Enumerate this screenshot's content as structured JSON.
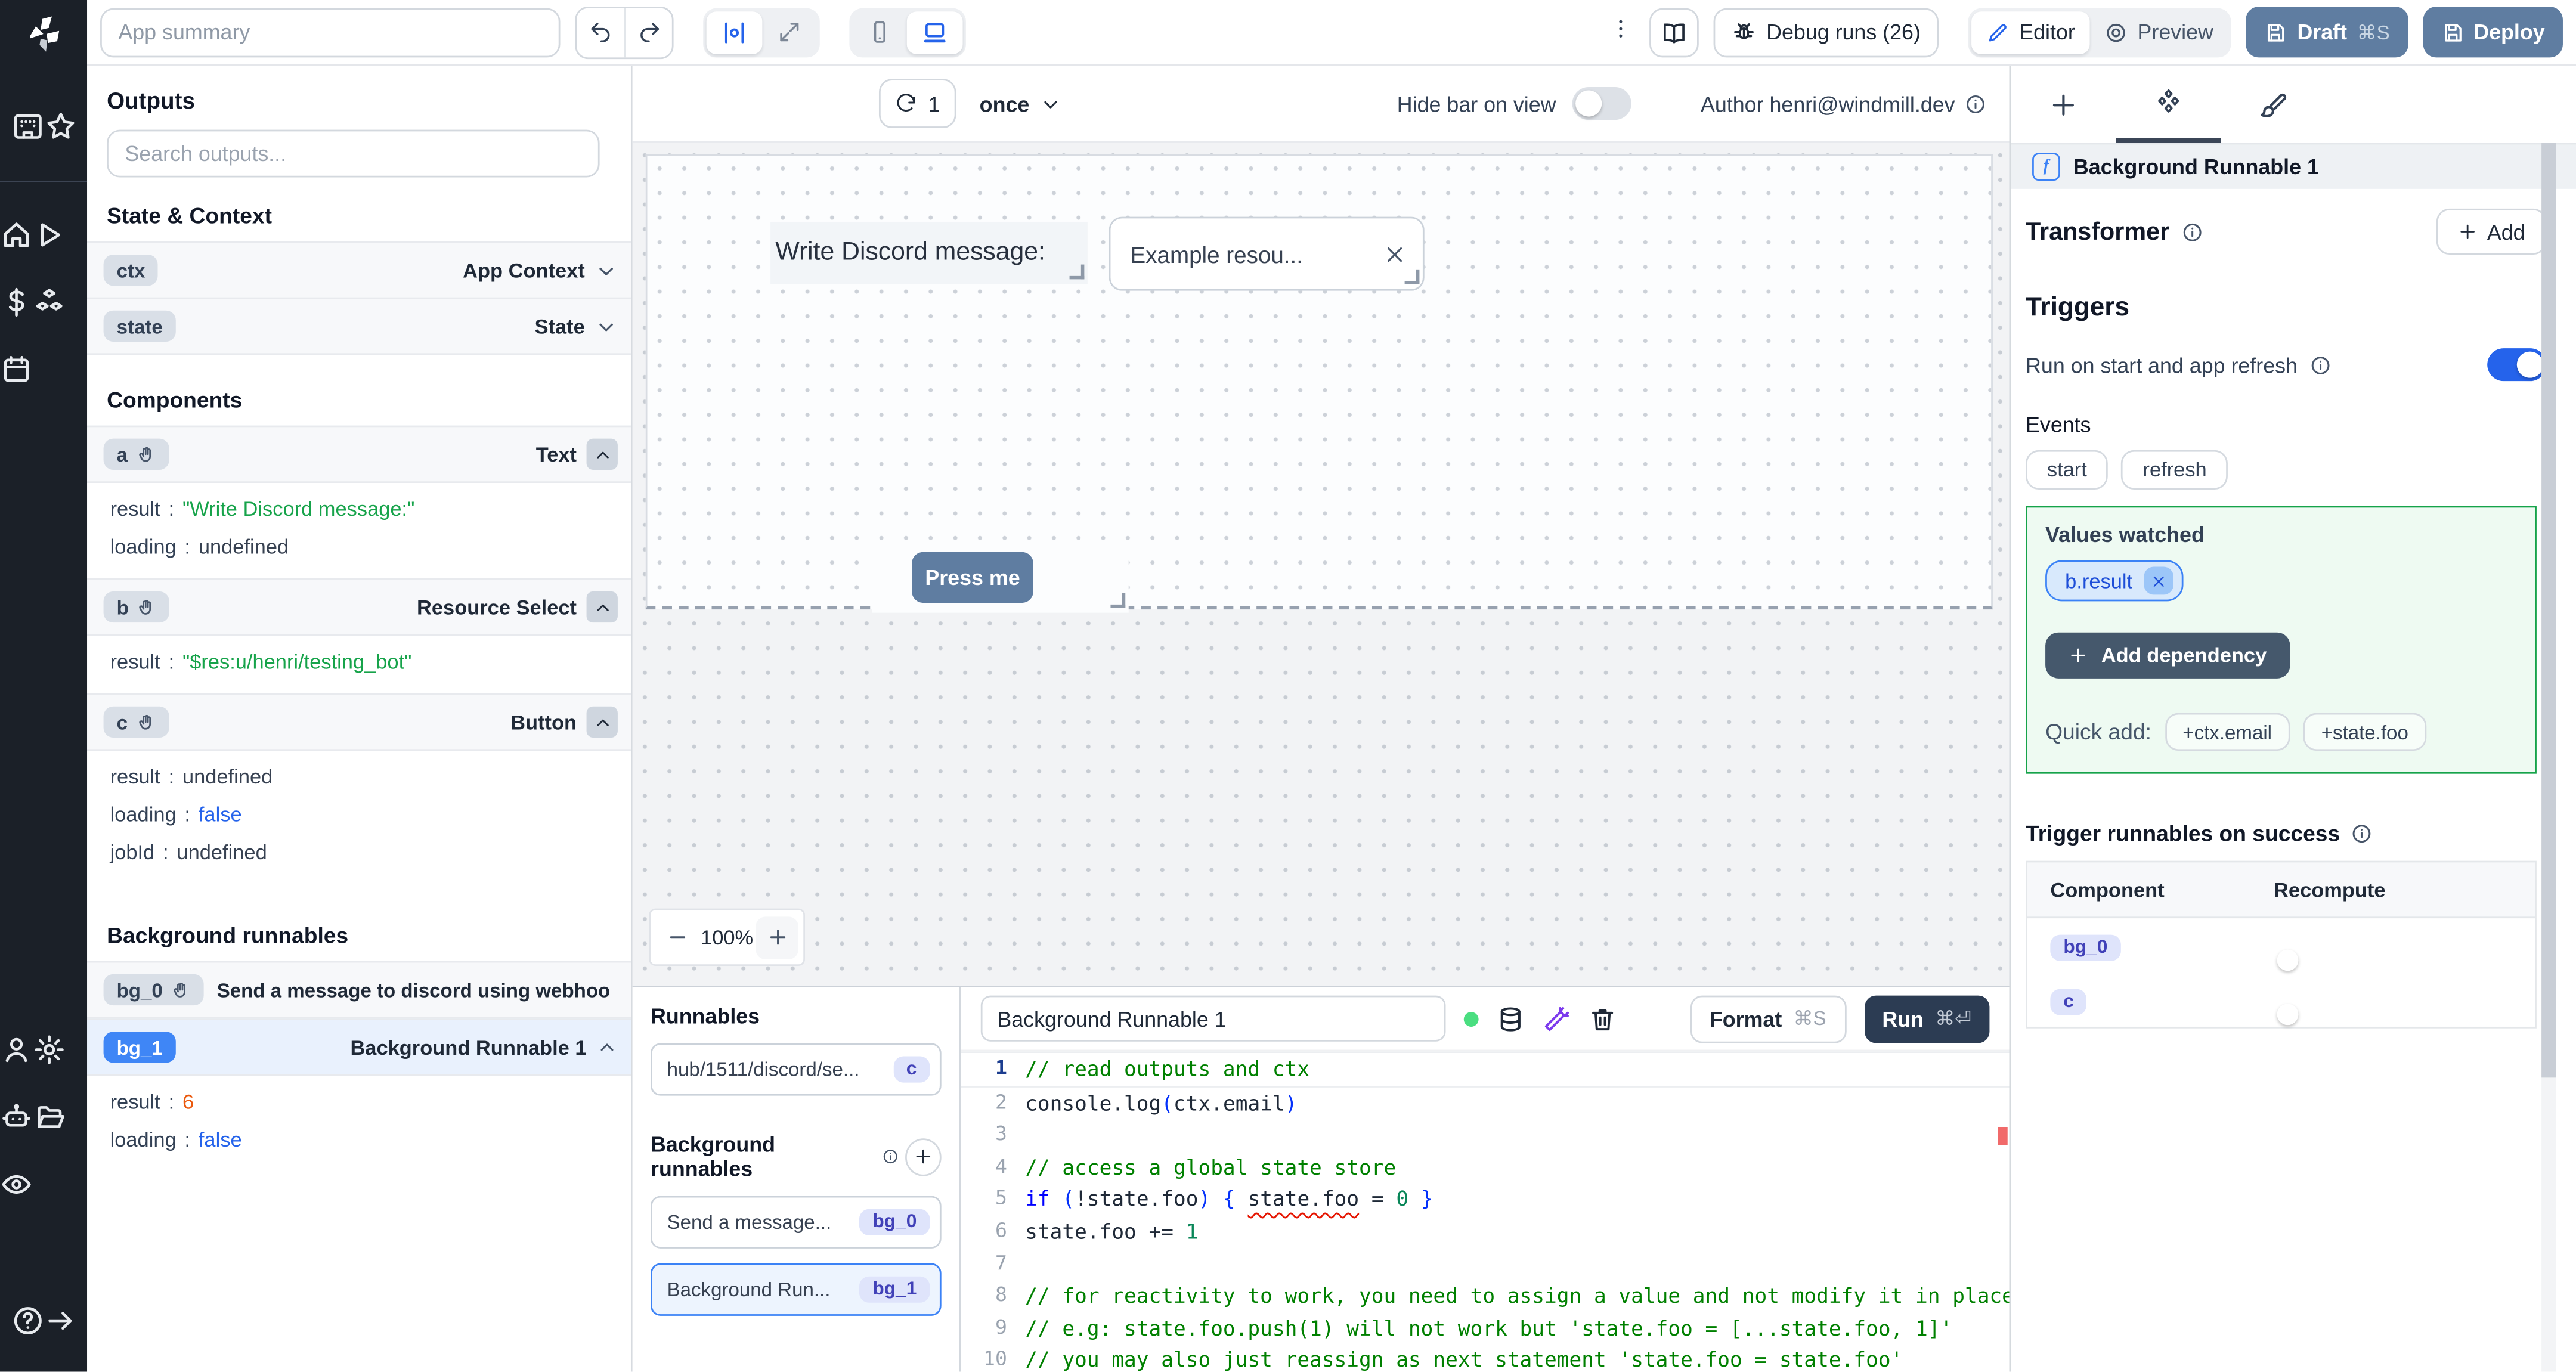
{
  "topbar": {
    "app_summary_placeholder": "App summary",
    "debug_runs_label": "Debug runs (26)",
    "editor_label": "Editor",
    "preview_label": "Preview",
    "draft_label": "Draft",
    "draft_shortcut": "⌘S",
    "deploy_label": "Deploy"
  },
  "left_rail": {
    "top_icons": [
      "apps",
      "star"
    ],
    "mid_icons": [
      "home",
      "play",
      "dollar",
      "cubes",
      "calendar"
    ],
    "bottom_icons": [
      "user",
      "settings",
      "robot",
      "folder-open",
      "eye"
    ],
    "footer_icons": [
      "help-circle",
      "arrow-right"
    ]
  },
  "outputs_panel": {
    "title": "Outputs",
    "search_placeholder": "Search outputs...",
    "state_context_title": "State & Context",
    "state_context_rows": [
      {
        "id": "ctx",
        "type": "App Context"
      },
      {
        "id": "state",
        "type": "State"
      }
    ],
    "components_title": "Components",
    "components": [
      {
        "id": "a",
        "type": "Text",
        "props": [
          {
            "key": "result",
            "value": "\"Write Discord message:\"",
            "kind": "string"
          },
          {
            "key": "loading",
            "value": "undefined",
            "kind": "undefined"
          }
        ]
      },
      {
        "id": "b",
        "type": "Resource Select",
        "props": [
          {
            "key": "result",
            "value": "\"$res:u/henri/testing_bot\"",
            "kind": "string"
          }
        ]
      },
      {
        "id": "c",
        "type": "Button",
        "props": [
          {
            "key": "result",
            "value": "undefined",
            "kind": "undefined"
          },
          {
            "key": "loading",
            "value": "false",
            "kind": "bool"
          },
          {
            "key": "jobId",
            "value": "undefined",
            "kind": "undefined"
          }
        ]
      }
    ],
    "background_title": "Background runnables",
    "background": [
      {
        "id": "bg_0",
        "type": "Send a message to discord using webhoo",
        "selected": false,
        "label_left": true,
        "hand": true,
        "chevron": false,
        "props": []
      },
      {
        "id": "bg_1",
        "type": "Background Runnable 1",
        "selected": true,
        "label_left": false,
        "hand": false,
        "chevron": true,
        "props": [
          {
            "key": "result",
            "value": "6",
            "kind": "number"
          },
          {
            "key": "loading",
            "value": "false",
            "kind": "bool"
          }
        ]
      }
    ]
  },
  "canvas": {
    "refresh_count": "1",
    "frequency": "once",
    "hide_bar_label": "Hide bar on view",
    "author_label": "Author henri@windmill.dev",
    "zoom_label": "100%",
    "widgets": {
      "text": "Write Discord message:",
      "select_value": "Example resou...",
      "button_label": "Press me"
    }
  },
  "runnables_panel": {
    "title": "Runnables",
    "items": [
      {
        "label": "hub/1511/discord/se...",
        "badge": "c",
        "selected": false
      }
    ],
    "background_title": "Background runnables",
    "background_items": [
      {
        "label": "Send a message...",
        "badge": "bg_0",
        "selected": false
      },
      {
        "label": "Background Run...",
        "badge": "bg_1",
        "selected": true
      }
    ]
  },
  "code_editor": {
    "name_value": "Background Runnable 1",
    "format_label": "Format",
    "format_shortcut": "⌘S",
    "run_label": "Run",
    "run_shortcut": "⌘⏎",
    "lines": [
      {
        "active": true,
        "tokens": [
          [
            "// read outputs and ctx",
            "cmt"
          ]
        ]
      },
      {
        "tokens": [
          [
            "console.log",
            "pl"
          ],
          [
            "(",
            "br"
          ],
          [
            "ctx.email",
            "pl"
          ],
          [
            ")",
            "br"
          ]
        ]
      },
      {
        "tokens": []
      },
      {
        "tokens": [
          [
            "// access a global state store",
            "cmt"
          ]
        ]
      },
      {
        "tokens": [
          [
            "if",
            "kw"
          ],
          [
            " ",
            "pl"
          ],
          [
            "(",
            "br"
          ],
          [
            "!state.foo",
            "pl"
          ],
          [
            ")",
            "br"
          ],
          [
            " ",
            "pl"
          ],
          [
            "{",
            "br"
          ],
          [
            " ",
            "pl"
          ],
          [
            "state.foo",
            "sq"
          ],
          [
            " = ",
            "pl"
          ],
          [
            "0",
            "num"
          ],
          [
            " ",
            "pl"
          ],
          [
            "}",
            "br"
          ]
        ]
      },
      {
        "tokens": [
          [
            "state.foo += ",
            "pl"
          ],
          [
            "1",
            "num"
          ]
        ]
      },
      {
        "tokens": []
      },
      {
        "tokens": [
          [
            "// for reactivity to work, you need to assign a value and not modify it in place",
            "cmt"
          ]
        ]
      },
      {
        "tokens": [
          [
            "// e.g: state.foo.push(1) will not work but 'state.foo = [...state.foo, 1]'",
            "cmt"
          ]
        ]
      },
      {
        "tokens": [
          [
            "// you may also just reassign as next statement 'state.foo = state.foo'",
            "cmt"
          ]
        ]
      }
    ]
  },
  "right_panel": {
    "header_title": "Background Runnable 1",
    "transformer_title": "Transformer",
    "add_label": "Add",
    "triggers_title": "Triggers",
    "run_on_start_label": "Run on start and app refresh",
    "run_on_start_enabled": true,
    "events_label": "Events",
    "event_pills": [
      "start",
      "refresh"
    ],
    "values_watched_label": "Values watched",
    "watched_chips": [
      "b.result"
    ],
    "add_dependency_label": "Add dependency",
    "quick_add_label": "Quick add:",
    "quick_add_pills": [
      "+ctx.email",
      "+state.foo"
    ],
    "trigger_success_title": "Trigger runnables on success",
    "table": {
      "columns": [
        "Component",
        "Recompute"
      ],
      "rows": [
        {
          "component": "bg_0",
          "recompute": false
        },
        {
          "component": "c",
          "recompute": false
        }
      ]
    }
  }
}
